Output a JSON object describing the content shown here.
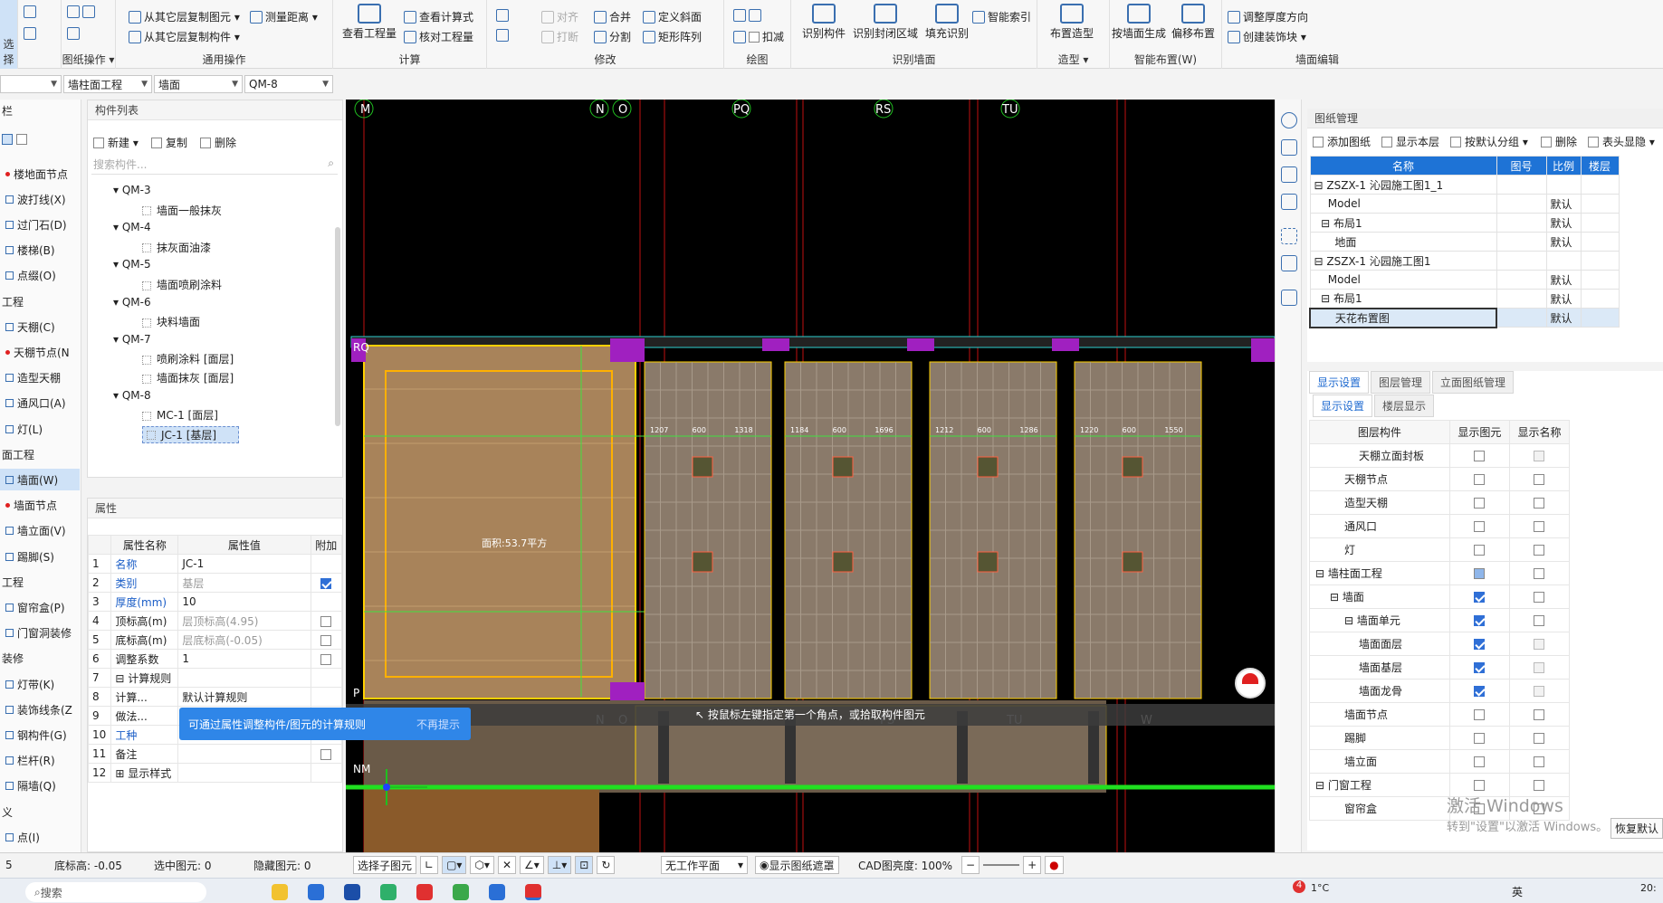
{
  "ribbon": {
    "groups": [
      {
        "label": "选择"
      },
      {
        "label": "图纸操作 ▾"
      },
      {
        "label": "通用操作"
      },
      {
        "label": "计算"
      },
      {
        "label": "修改"
      },
      {
        "label": "绘图"
      },
      {
        "label": "识别墙面"
      },
      {
        "label": "造型 ▾"
      },
      {
        "label": "智能布置(W)"
      },
      {
        "label": "墙面编辑"
      }
    ],
    "items": {
      "copy_from_floor": "从其它层复制图元 ▾",
      "copy_component": "从其它层复制构件 ▾",
      "measure": "测量距离 ▾",
      "view_qty": "查看工程量",
      "view_formula": "查看计算式",
      "check_qty": "核对工程量",
      "align": "对齐",
      "merge": "合并",
      "define_slope": "定义斜面",
      "break": "打断",
      "split": "分割",
      "rect_array": "矩形阵列",
      "deduct": "扣减",
      "recog_comp": "识别构件",
      "recog_closed": "识别封闭区域",
      "fill_recog": "填充识别",
      "smart_index": "智能索引",
      "layout_shape": "布置造型",
      "gen_by_wall": "按墙面生成",
      "offset_layout": "偏移布置",
      "adjust_thickness": "调整厚度方向",
      "create_decor": "创建装饰块 ▾"
    }
  },
  "filter_bar": {
    "combo1": "",
    "combo2": "墙柱面工程",
    "combo3": "墙面",
    "combo4": "QM-8"
  },
  "left_nav": [
    {
      "label": "楼地面节点",
      "type": "dot"
    },
    {
      "label": "波打线(X)",
      "type": "icon"
    },
    {
      "label": "过门石(D)",
      "type": "icon"
    },
    {
      "label": "楼梯(B)",
      "type": "icon"
    },
    {
      "label": "点缀(O)",
      "type": "icon"
    },
    {
      "label": "工程",
      "type": "section"
    },
    {
      "label": "天棚(C)",
      "type": "icon"
    },
    {
      "label": "天棚节点(N",
      "type": "dot"
    },
    {
      "label": "造型天棚",
      "type": "icon"
    },
    {
      "label": "通风口(A)",
      "type": "icon"
    },
    {
      "label": "灯(L)",
      "type": "icon"
    },
    {
      "label": "面工程",
      "type": "section"
    },
    {
      "label": "墙面(W)",
      "type": "icon",
      "selected": true
    },
    {
      "label": "墙面节点",
      "type": "dot"
    },
    {
      "label": "墙立面(V)",
      "type": "icon"
    },
    {
      "label": "踢脚(S)",
      "type": "icon"
    },
    {
      "label": "工程",
      "type": "section"
    },
    {
      "label": "窗帘盒(P)",
      "type": "icon"
    },
    {
      "label": "门窗洞装修",
      "type": "icon"
    },
    {
      "label": "装修",
      "type": "section"
    },
    {
      "label": "灯带(K)",
      "type": "icon"
    },
    {
      "label": "装饰线条(Z",
      "type": "icon"
    },
    {
      "label": "钢构件(G)",
      "type": "icon"
    },
    {
      "label": "栏杆(R)",
      "type": "icon"
    },
    {
      "label": "隔墙(Q)",
      "type": "icon"
    },
    {
      "label": "义",
      "type": "section"
    },
    {
      "label": "点(I)",
      "type": "icon"
    }
  ],
  "left_header": "栏",
  "component_list": {
    "title": "构件列表",
    "new": "新建 ▾",
    "copy": "复制",
    "delete": "删除",
    "search_placeholder": "搜索构件...",
    "tree": [
      {
        "label": "QM-3",
        "level": 0
      },
      {
        "label": "墙面一般抹灰",
        "level": 1
      },
      {
        "label": "QM-4",
        "level": 0
      },
      {
        "label": "抹灰面油漆",
        "level": 1
      },
      {
        "label": "QM-5",
        "level": 0
      },
      {
        "label": "墙面喷刷涂料",
        "level": 1
      },
      {
        "label": "QM-6",
        "level": 0
      },
      {
        "label": "块料墙面",
        "level": 1
      },
      {
        "label": "QM-7",
        "level": 0
      },
      {
        "label": "喷刷涂料 [面层]",
        "level": 1
      },
      {
        "label": "墙面抹灰 [面层]",
        "level": 1
      },
      {
        "label": "QM-8",
        "level": 0
      },
      {
        "label": "MC-1 [面层]",
        "level": 1
      },
      {
        "label": "JC-1 [基层]",
        "level": 1,
        "selected": true
      }
    ]
  },
  "properties": {
    "title": "属性",
    "headers": [
      "属性名称",
      "属性值",
      "附加"
    ],
    "rows": [
      {
        "no": "1",
        "name": "名称",
        "value": "JC-1",
        "blue": true,
        "check": null
      },
      {
        "no": "2",
        "name": "类别",
        "value": "基层",
        "blue": true,
        "grey": true,
        "check": "on"
      },
      {
        "no": "3",
        "name": "厚度(mm)",
        "value": "10",
        "blue": true,
        "check": null
      },
      {
        "no": "4",
        "name": "顶标高(m)",
        "value": "层顶标高(4.95)",
        "grey": true,
        "check": "off"
      },
      {
        "no": "5",
        "name": "底标高(m)",
        "value": "层底标高(-0.05)",
        "grey": true,
        "check": "off"
      },
      {
        "no": "6",
        "name": "调整系数",
        "value": "1",
        "check": "off"
      },
      {
        "no": "7",
        "name": "⊟ 计算规则",
        "value": "",
        "check": null
      },
      {
        "no": "8",
        "name": "  计算...",
        "value": "默认计算规则",
        "check": null
      },
      {
        "no": "9",
        "name": "  做法...",
        "value": "无",
        "check": null
      },
      {
        "no": "10",
        "name": "工种",
        "value": "",
        "blue": true,
        "check": null
      },
      {
        "no": "11",
        "name": "备注",
        "value": "",
        "check": "off"
      },
      {
        "no": "12",
        "name": "⊞ 显示样式",
        "value": "",
        "check": null
      }
    ],
    "tooltip": "可通过属性调整构件/图元的计算规则",
    "tooltip_dismiss": "不再提示"
  },
  "canvas": {
    "axis_top": [
      "M",
      "N",
      "O",
      "PQ",
      "RS",
      "TU"
    ],
    "axis_bottom": [
      "M",
      "N",
      "O",
      "PS",
      "TU",
      "W"
    ],
    "axis_left": [
      "RQ",
      "P",
      "NM"
    ],
    "area_label": "面积:53.7平方",
    "prompt": "按鼠标左键指定第一个角点，或拾取构件图元",
    "dims": [
      "1207",
      "600",
      "1318",
      "1184",
      "600",
      "1696",
      "1212",
      "600",
      "1286",
      "1220",
      "600",
      "1550"
    ]
  },
  "drawing_mgr": {
    "title": "图纸管理",
    "add": "添加图纸",
    "show_floor": "显示本层",
    "group_default": "按默认分组 ▾",
    "delete": "删除",
    "header_show": "表头显隐 ▾",
    "headers": [
      "名称",
      "图号",
      "比例",
      "楼层"
    ],
    "rows": [
      {
        "name": "⊟ ZSZX-1 沁园施工图1_1",
        "no": "",
        "scale": "",
        "floor": ""
      },
      {
        "name": "    Model",
        "no": "",
        "scale": "默认",
        "floor": ""
      },
      {
        "name": "  ⊟ 布局1",
        "no": "",
        "scale": "默认",
        "floor": ""
      },
      {
        "name": "      地面",
        "no": "",
        "scale": "默认",
        "floor": ""
      },
      {
        "name": "⊟ ZSZX-1 沁园施工图1",
        "no": "",
        "scale": "",
        "floor": ""
      },
      {
        "name": "    Model",
        "no": "",
        "scale": "默认",
        "floor": ""
      },
      {
        "name": "  ⊟ 布局1",
        "no": "",
        "scale": "默认",
        "floor": ""
      },
      {
        "name": "      天花布置图",
        "no": "",
        "scale": "默认",
        "floor": "",
        "selected": true
      }
    ]
  },
  "display_settings": {
    "outer_tabs": [
      "显示设置",
      "图层管理",
      "立面图纸管理"
    ],
    "inner_tabs": [
      "显示设置",
      "楼层显示"
    ],
    "headers": [
      "图层构件",
      "显示图元",
      "显示名称"
    ],
    "rows": [
      {
        "name": "天棚立面封板",
        "indent": 3,
        "show": "off",
        "name_show": "grey"
      },
      {
        "name": "天棚节点",
        "indent": 2,
        "show": "off",
        "name_show": "off"
      },
      {
        "name": "造型天棚",
        "indent": 2,
        "show": "off",
        "name_show": "off"
      },
      {
        "name": "通风口",
        "indent": 2,
        "show": "off",
        "name_show": "off"
      },
      {
        "name": "灯",
        "indent": 2,
        "show": "off",
        "name_show": "off"
      },
      {
        "name": "⊟ 墙柱面工程",
        "indent": 0,
        "show": "part",
        "name_show": "off"
      },
      {
        "name": "⊟ 墙面",
        "indent": 1,
        "show": "on",
        "name_show": "off"
      },
      {
        "name": "⊟ 墙面单元",
        "indent": 2,
        "show": "on",
        "name_show": "off"
      },
      {
        "name": "墙面面层",
        "indent": 3,
        "show": "on",
        "name_show": "grey"
      },
      {
        "name": "墙面基层",
        "indent": 3,
        "show": "on",
        "name_show": "grey"
      },
      {
        "name": "墙面龙骨",
        "indent": 3,
        "show": "on",
        "name_show": "grey"
      },
      {
        "name": "墙面节点",
        "indent": 2,
        "show": "off",
        "name_show": "off"
      },
      {
        "name": "踢脚",
        "indent": 2,
        "show": "off",
        "name_show": "off"
      },
      {
        "name": "墙立面",
        "indent": 2,
        "show": "off",
        "name_show": "off"
      },
      {
        "name": "⊟ 门窗工程",
        "indent": 0,
        "show": "off",
        "name_show": "off"
      },
      {
        "name": "窗帘盒",
        "indent": 2,
        "show": "off",
        "name_show": "off"
      }
    ],
    "restore": "恢复默认"
  },
  "watermark": {
    "line1": "激活 Windows",
    "line2": "转到\"设置\"以激活 Windows。"
  },
  "status": {
    "floor": "5",
    "bottom_elev": "底标高: -0.05",
    "selected": "选中图元: 0",
    "hidden": "隐藏图元: 0",
    "select_sub": "选择子图元",
    "work_plane": "无工作平面",
    "show_mask": "显示图纸遮罩",
    "cad_brightness": "CAD图亮度: 100%"
  },
  "taskbar": {
    "search": "搜索",
    "weather": "1°C",
    "badge": "4",
    "ime": "英",
    "time": "20:"
  }
}
